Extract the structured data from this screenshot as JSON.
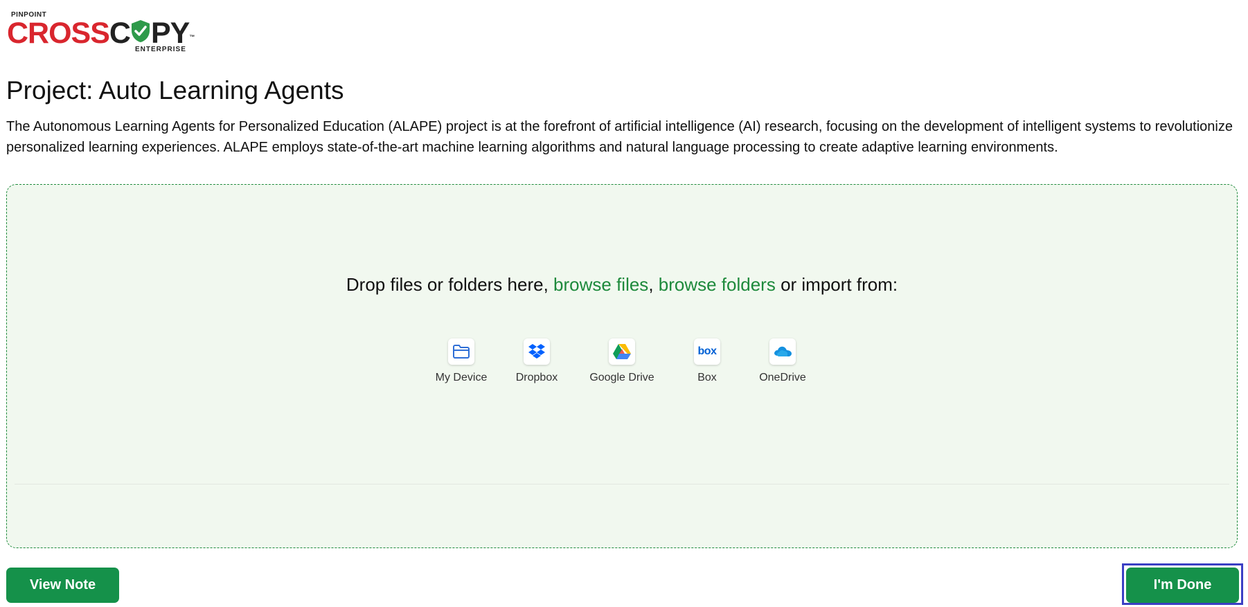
{
  "brand": {
    "top": "PINPOINT",
    "cross": "CROSS",
    "c": "C",
    "py": "PY",
    "tm": "™",
    "bottom": "ENTERPRISE",
    "colors": {
      "red": "#d9262e",
      "dark": "#222222",
      "green": "#2e9a4a"
    }
  },
  "project": {
    "title": "Project: Auto Learning Agents",
    "description": "The Autonomous Learning Agents for Personalized Education (ALAPE) project is at the forefront of artificial intelligence (AI) research, focusing on the development of intelligent systems to revolutionize personalized learning experiences. ALAPE employs state-of-the-art machine learning algorithms and natural language processing to create adaptive learning environments."
  },
  "dropzone": {
    "prefix": "Drop files or folders here, ",
    "browse_files": "browse files",
    "separator": ", ",
    "browse_folders": "browse folders",
    "suffix": " or import from:",
    "sources": [
      {
        "label": "My Device",
        "icon": "folder-icon"
      },
      {
        "label": "Dropbox",
        "icon": "dropbox-icon"
      },
      {
        "label": "Google Drive",
        "icon": "google-drive-icon"
      },
      {
        "label": "Box",
        "icon": "box-icon"
      },
      {
        "label": "OneDrive",
        "icon": "onedrive-icon"
      }
    ],
    "box_text": "box"
  },
  "actions": {
    "view_note": "View Note",
    "done": "I'm Done"
  },
  "colors": {
    "accent": "#15914a",
    "link": "#1e8a3c",
    "dropzone_bg": "#f1f8ef",
    "focus_frame": "#3b3fc4"
  }
}
